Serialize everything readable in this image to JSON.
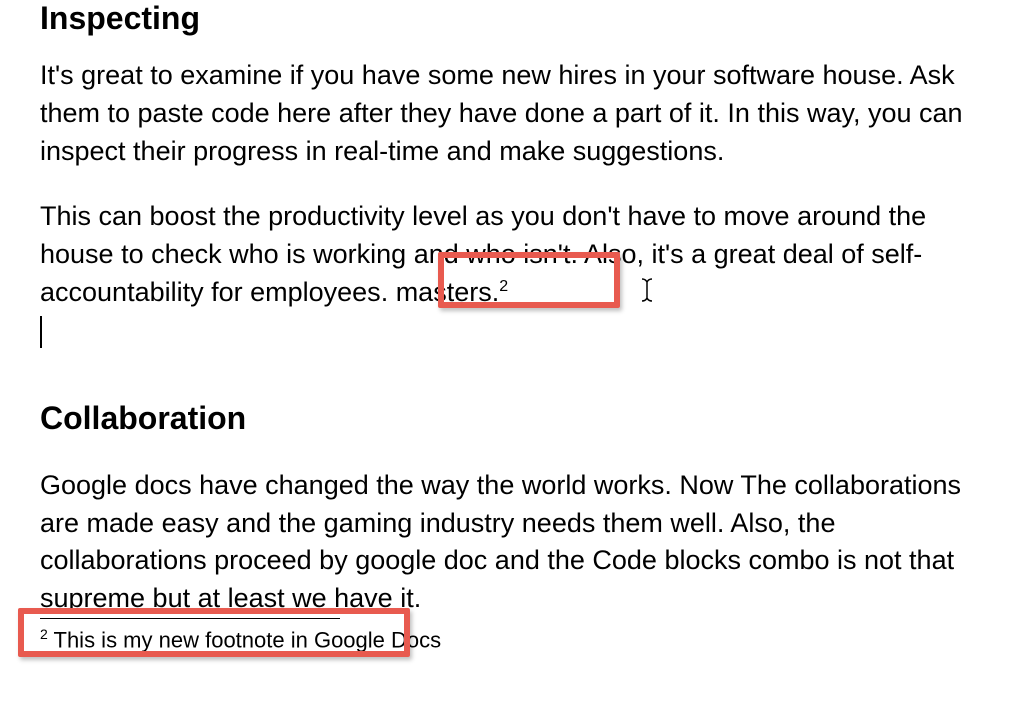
{
  "headings": {
    "h1": "Inspecting",
    "h2": "Collaboration"
  },
  "paragraphs": {
    "p1": "It's great to examine if you have some new hires in your software house. Ask them to paste code here after they have done a part of it. In this way, you can inspect their progress in real-time and make suggestions.",
    "p2_a": "This can boost the productivity level as you don't have to move around the house to check who is working and who isn't. Also, it's a great deal of self-accountability for employees",
    "p2_b": ". masters.",
    "p2_sup": "2",
    "p3": "Google docs have changed the way the world works. Now The collaborations are made easy and the gaming industry needs them well. Also, the collaborations proceed by google doc and the Code blocks combo is not that supreme but at least we have it."
  },
  "footnote": {
    "marker": "2",
    "text": " This is my new footnote in Google Docs"
  },
  "icons": {
    "text_cursor": "I"
  }
}
